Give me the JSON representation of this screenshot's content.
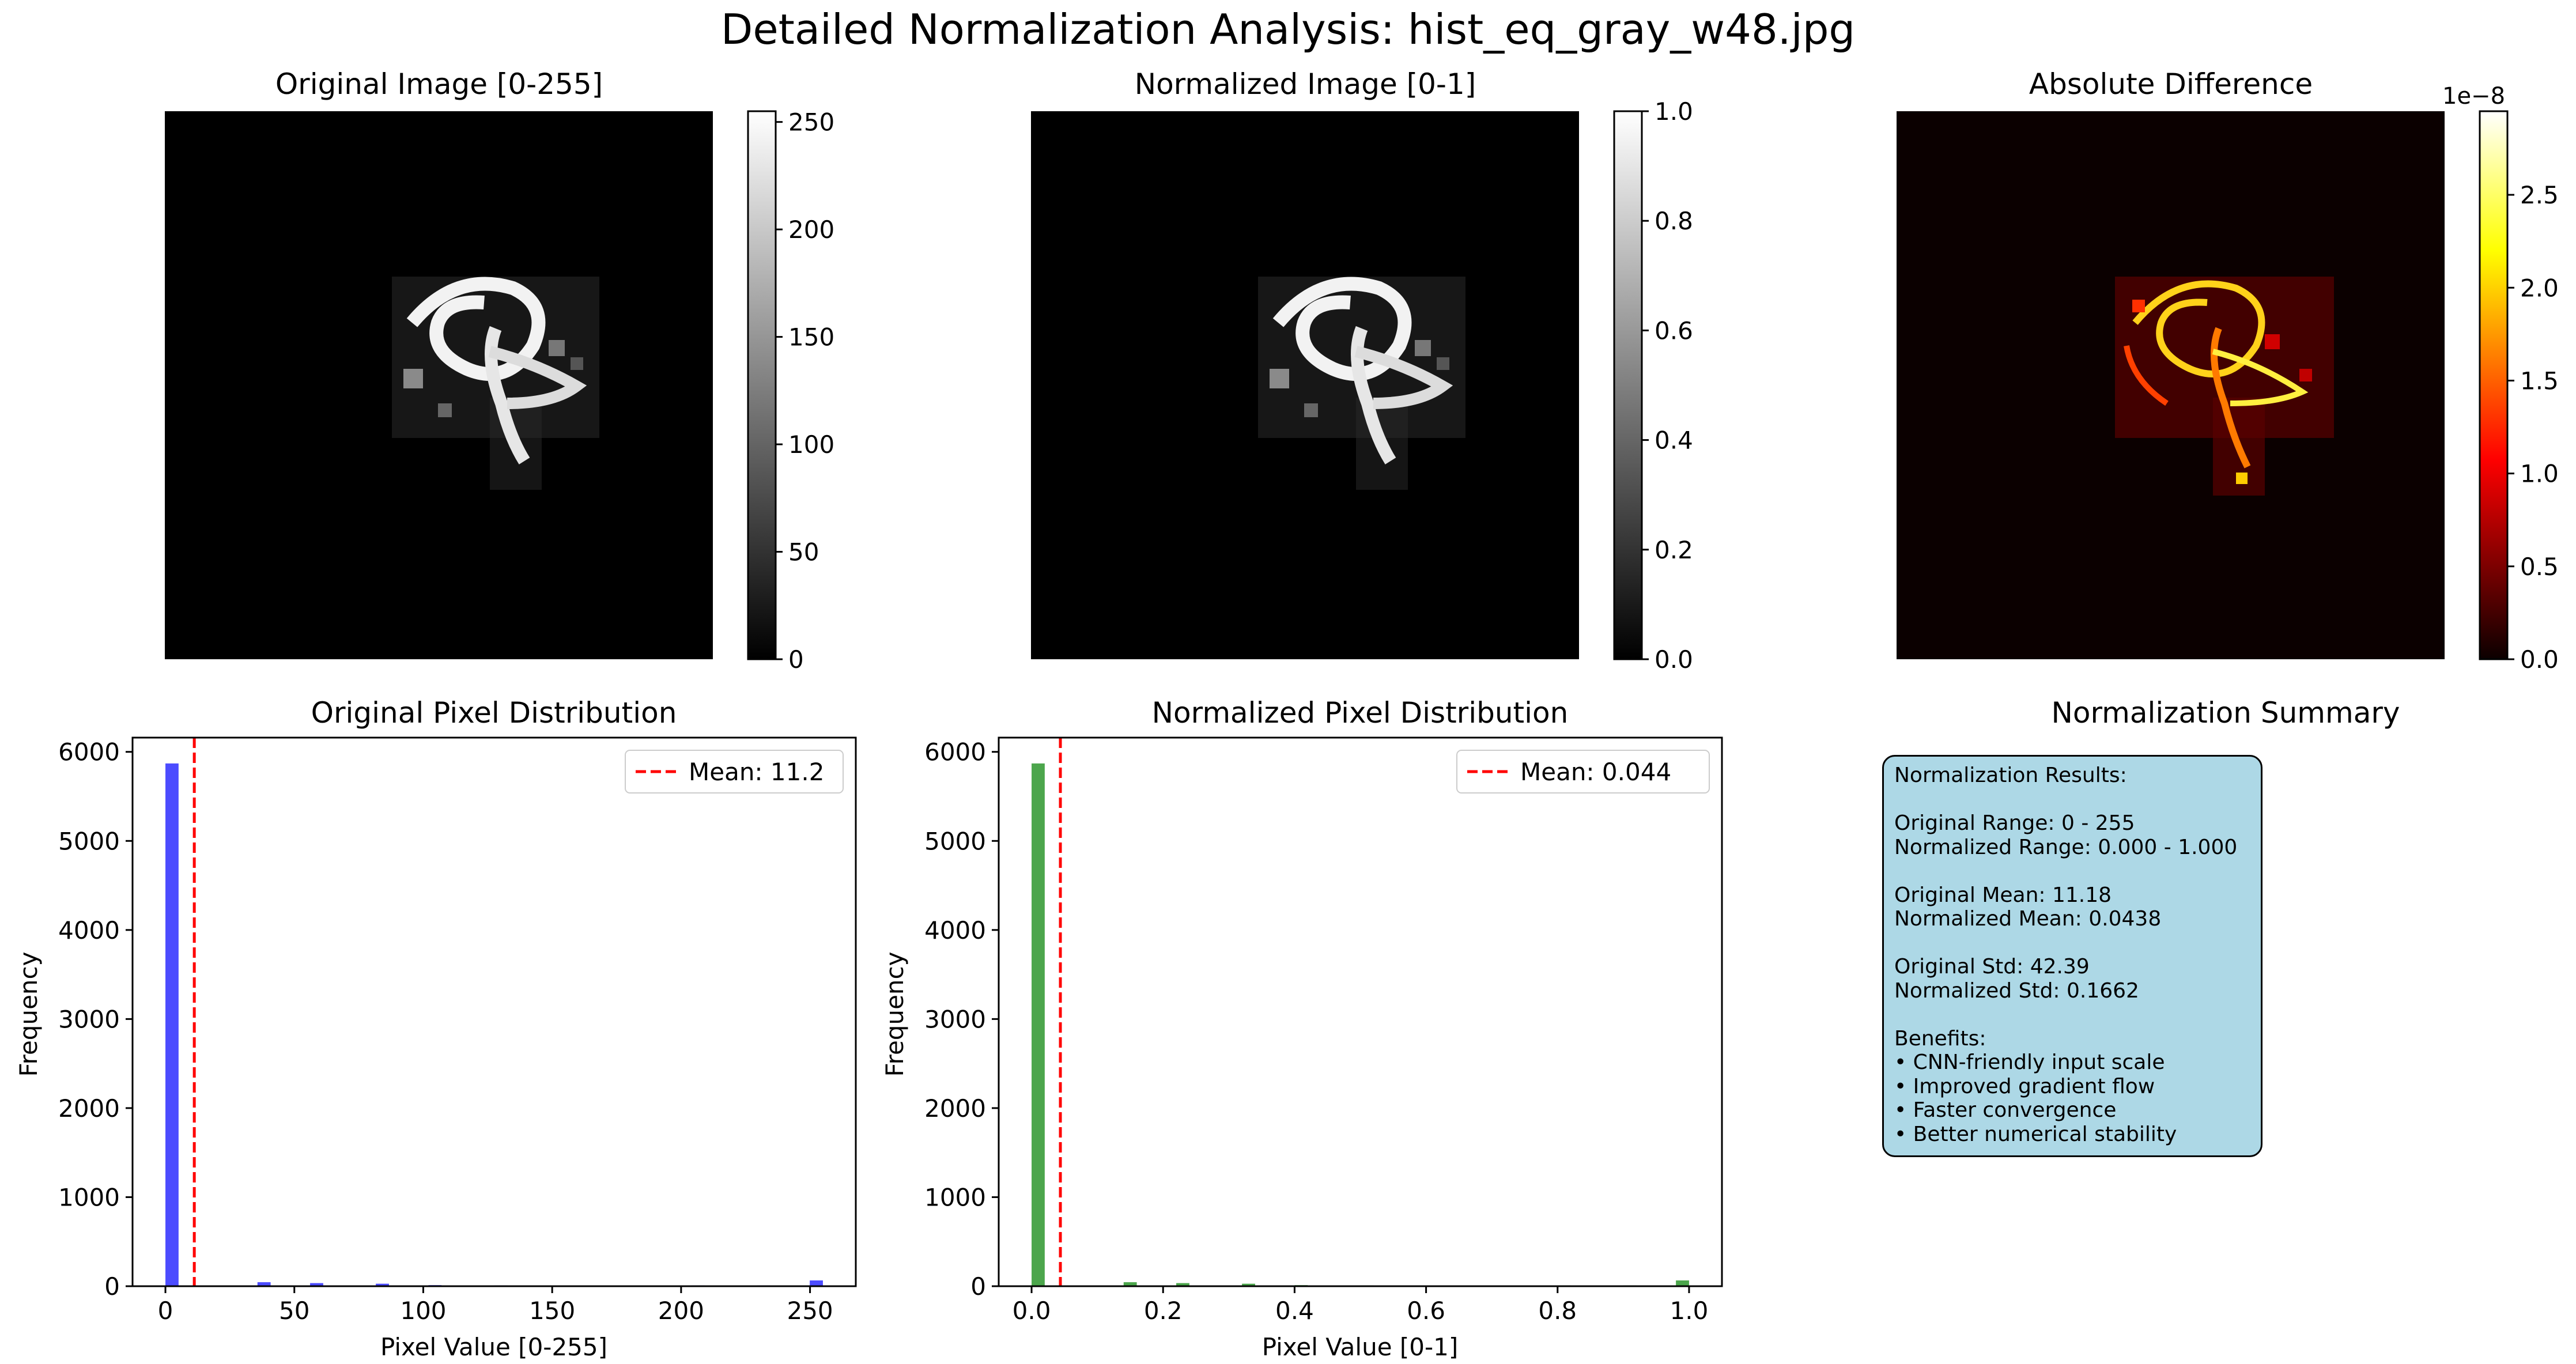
{
  "figure_title": "Detailed Normalization Analysis: hist_eq_gray_w48.jpg",
  "colors": {
    "original_bars": "#0000ff",
    "normalized_bars": "#008000",
    "mean_line": "#ff0000",
    "summary_box": "#add8e6"
  },
  "images": {
    "original": {
      "title": "Original Image [0-255]",
      "colormap": "gray",
      "colorbar_ticks": [
        "0",
        "50",
        "100",
        "150",
        "200",
        "250"
      ],
      "colorbar_range": [
        0,
        255
      ]
    },
    "normalized": {
      "title": "Normalized Image [0-1]",
      "colormap": "gray",
      "colorbar_ticks": [
        "0.0",
        "0.2",
        "0.4",
        "0.6",
        "0.8",
        "1.0"
      ],
      "colorbar_range": [
        0,
        1
      ]
    },
    "difference": {
      "title": "Absolute Difference",
      "colormap": "hot",
      "colorbar_ticks": [
        "0.0",
        "0.5",
        "1.0",
        "1.5",
        "2.0",
        "2.5"
      ],
      "colorbar_range": [
        0,
        2.95
      ],
      "colorbar_offset": "1e−8"
    }
  },
  "chart_data": [
    {
      "type": "bar",
      "title": "Original Pixel Distribution",
      "xlabel": "Pixel Value [0-255]",
      "ylabel": "Frequency",
      "xlim": [
        -12.75,
        267.75
      ],
      "ylim": [
        0,
        6160
      ],
      "x_ticks": [
        "0",
        "50",
        "100",
        "150",
        "200",
        "250"
      ],
      "y_ticks": [
        "0",
        "1000",
        "2000",
        "3000",
        "4000",
        "5000",
        "6000"
      ],
      "bin_width": 5.1,
      "bins": [
        {
          "x": 0,
          "count": 5870
        },
        {
          "x": 35.7,
          "count": 45
        },
        {
          "x": 56.1,
          "count": 35
        },
        {
          "x": 81.6,
          "count": 28
        },
        {
          "x": 102,
          "count": 12
        },
        {
          "x": 127.5,
          "count": 10
        },
        {
          "x": 153,
          "count": 8
        },
        {
          "x": 178.5,
          "count": 8
        },
        {
          "x": 204,
          "count": 10
        },
        {
          "x": 229.5,
          "count": 10
        },
        {
          "x": 249.9,
          "count": 65
        }
      ],
      "mean": 11.2,
      "legend": "Mean: 11.2",
      "legend_position": "upper right",
      "grid": false
    },
    {
      "type": "bar",
      "title": "Normalized Pixel Distribution",
      "xlabel": "Pixel Value [0-1]",
      "ylabel": "Frequency",
      "xlim": [
        -0.05,
        1.05
      ],
      "ylim": [
        0,
        6160
      ],
      "x_ticks": [
        "0.0",
        "0.2",
        "0.4",
        "0.6",
        "0.8",
        "1.0"
      ],
      "y_ticks": [
        "0",
        "1000",
        "2000",
        "3000",
        "4000",
        "5000",
        "6000"
      ],
      "bin_width": 0.02,
      "bins": [
        {
          "x": 0,
          "count": 5870
        },
        {
          "x": 0.14,
          "count": 45
        },
        {
          "x": 0.22,
          "count": 35
        },
        {
          "x": 0.32,
          "count": 28
        },
        {
          "x": 0.4,
          "count": 12
        },
        {
          "x": 0.5,
          "count": 10
        },
        {
          "x": 0.6,
          "count": 8
        },
        {
          "x": 0.7,
          "count": 8
        },
        {
          "x": 0.8,
          "count": 10
        },
        {
          "x": 0.9,
          "count": 10
        },
        {
          "x": 0.98,
          "count": 65
        }
      ],
      "mean": 0.0438,
      "legend": "Mean: 0.044",
      "legend_position": "upper right",
      "grid": false
    }
  ],
  "summary": {
    "title": "Normalization Summary",
    "lines": [
      "Normalization Results:",
      "",
      "Original Range: 0 - 255",
      "Normalized Range: 0.000 - 1.000",
      "",
      "Original Mean: 11.18",
      "Normalized Mean: 0.0438",
      "",
      "Original Std: 42.39",
      "Normalized Std: 0.1662",
      "",
      "Benefits:",
      "• CNN-friendly input scale",
      "• Improved gradient flow",
      "• Faster convergence",
      "• Better numerical stability"
    ]
  }
}
